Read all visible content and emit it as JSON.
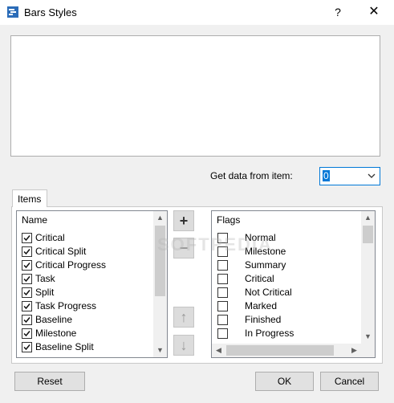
{
  "window": {
    "title": "Bars Styles",
    "help_glyph": "?",
    "close_glyph": "✕",
    "icon": "app-icon"
  },
  "get_data": {
    "label": "Get data from item:",
    "value": "0"
  },
  "tabs": [
    {
      "label": "Items"
    }
  ],
  "items_list": {
    "header": "Name",
    "rows": [
      {
        "label": "Critical",
        "checked": true
      },
      {
        "label": "Critical Split",
        "checked": true
      },
      {
        "label": "Critical Progress",
        "checked": true
      },
      {
        "label": "Task",
        "checked": true
      },
      {
        "label": "Split",
        "checked": true
      },
      {
        "label": "Task Progress",
        "checked": true
      },
      {
        "label": "Baseline",
        "checked": true
      },
      {
        "label": "Milestone",
        "checked": true
      },
      {
        "label": "Baseline Split",
        "checked": true
      }
    ]
  },
  "flags_list": {
    "header": "Flags",
    "rows": [
      {
        "label": "Normal",
        "checked": false
      },
      {
        "label": "Milestone",
        "checked": false
      },
      {
        "label": "Summary",
        "checked": false
      },
      {
        "label": "Critical",
        "checked": false
      },
      {
        "label": "Not Critical",
        "checked": false
      },
      {
        "label": "Marked",
        "checked": false
      },
      {
        "label": "Finished",
        "checked": false
      },
      {
        "label": "In Progress",
        "checked": false
      }
    ]
  },
  "side_buttons": {
    "add": "+",
    "remove": "−",
    "up": "↑",
    "down": "↓"
  },
  "footer": {
    "reset": "Reset",
    "ok": "OK",
    "cancel": "Cancel"
  },
  "watermark": "SOFTPEDIA",
  "colors": {
    "accent": "#0078d7",
    "dialog_bg": "#f0f0f0"
  }
}
